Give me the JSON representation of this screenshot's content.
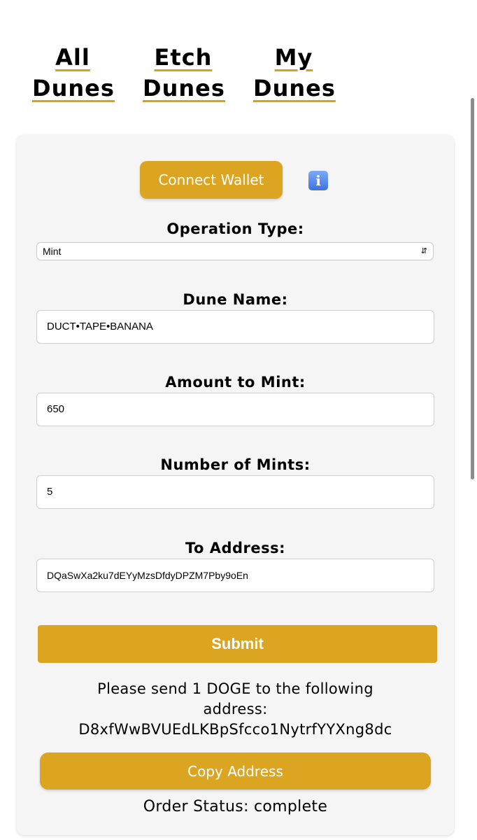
{
  "nav": {
    "all_dunes_line1": "All",
    "all_dunes_line2": "Dunes",
    "etch_dunes_line1": "Etch",
    "etch_dunes_line2": "Dunes",
    "my_dunes_line1": "My",
    "my_dunes_line2": "Dunes"
  },
  "toolbar": {
    "connect_label": "Connect Wallet",
    "info_icon": "info-icon"
  },
  "form": {
    "operation_label": "Operation Type:",
    "operation_value": "Mint",
    "dune_name_label": "Dune Name:",
    "dune_name_value": "DUCT•TAPE•BANANA",
    "amount_label": "Amount to Mint:",
    "amount_value": "650",
    "mints_label": "Number of Mints:",
    "mints_value": "5",
    "address_label": "To Address:",
    "address_value": "DQaSwXa2ku7dEYyMzsDfdyDPZM7Pby9oEn",
    "submit_label": "Submit"
  },
  "payment": {
    "message_line1": "Please send 1 DOGE to the following",
    "message_line2": "address:",
    "address": "D8xfWwBVUEdLKBpSfcco1NytrfYYXng8dc",
    "copy_label": "Copy Address",
    "order_status": "Order Status: complete"
  },
  "colors": {
    "accent": "#dba521",
    "card_bg": "#f5f5f5"
  }
}
